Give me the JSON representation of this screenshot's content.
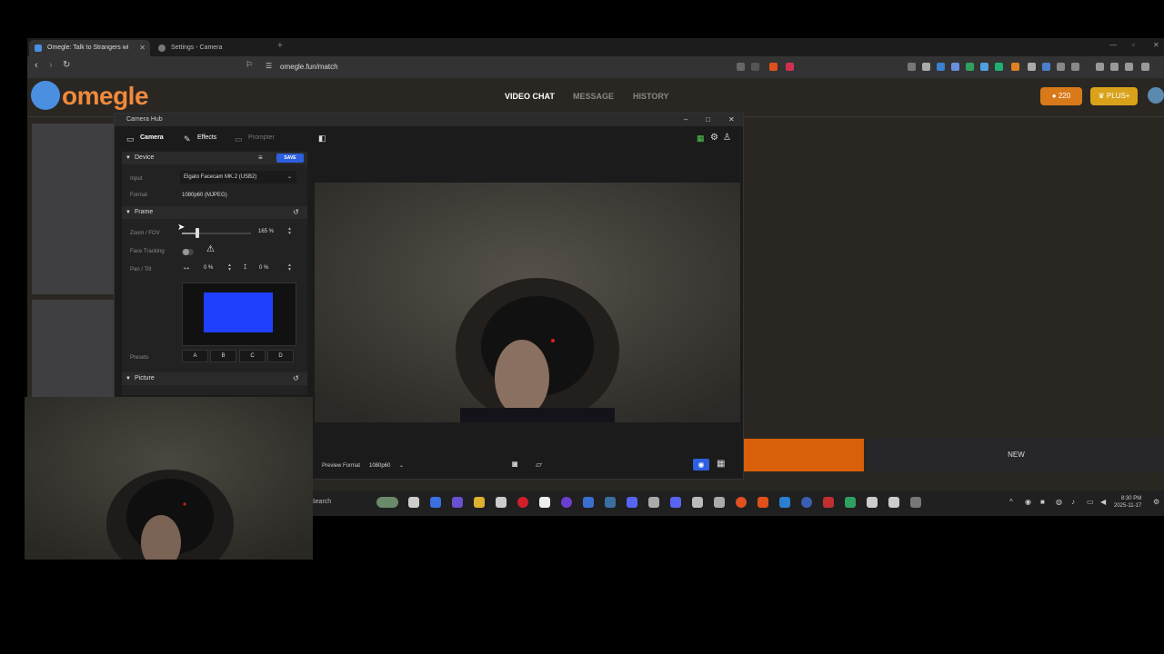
{
  "browser": {
    "tabs": [
      {
        "label": "Omegle: Talk to Strangers wi"
      },
      {
        "label": "Settings - Camera"
      }
    ],
    "url": "omegle.fun/match"
  },
  "omegle": {
    "logo": "omegle",
    "nav": [
      "VIDEO CHAT",
      "MESSAGE",
      "HISTORY"
    ],
    "coins": "220",
    "plus_label": "PLUS+",
    "new_button": "NEW"
  },
  "camhub": {
    "title": "Camera Hub",
    "tabs": [
      "Camera",
      "Effects",
      "Prompter"
    ],
    "device": {
      "section": "Device",
      "save_label": "SAVE",
      "input_label": "Input",
      "input_value": "Elgato Facecam MK.2 (USB2)",
      "format_label": "Format",
      "format_value": "1080p60 (MJPEG)"
    },
    "frame": {
      "section": "Frame",
      "zoom_label": "Zoom / FOV",
      "zoom_value": "165 %",
      "zoom_level": 0.21,
      "face_tracking_label": "Face Tracking",
      "face_tracking_on": false,
      "pan_tilt_label": "Pan / Tilt",
      "pan_value": "0 %",
      "tilt_value": "0 %",
      "presets_label": "Presets",
      "presets": [
        "A",
        "B",
        "C",
        "D"
      ]
    },
    "picture": {
      "section": "Picture"
    },
    "preview_format_label": "Preview Format",
    "preview_format_value": "1080p60"
  },
  "taskbar": {
    "search": "Search",
    "time": "8:30 PM",
    "date": "2025-11-17"
  },
  "colors": {
    "omegle_orange": "#f08a3c",
    "accent_blue": "#2d5fe0",
    "framing_blue": "#2040ff"
  }
}
